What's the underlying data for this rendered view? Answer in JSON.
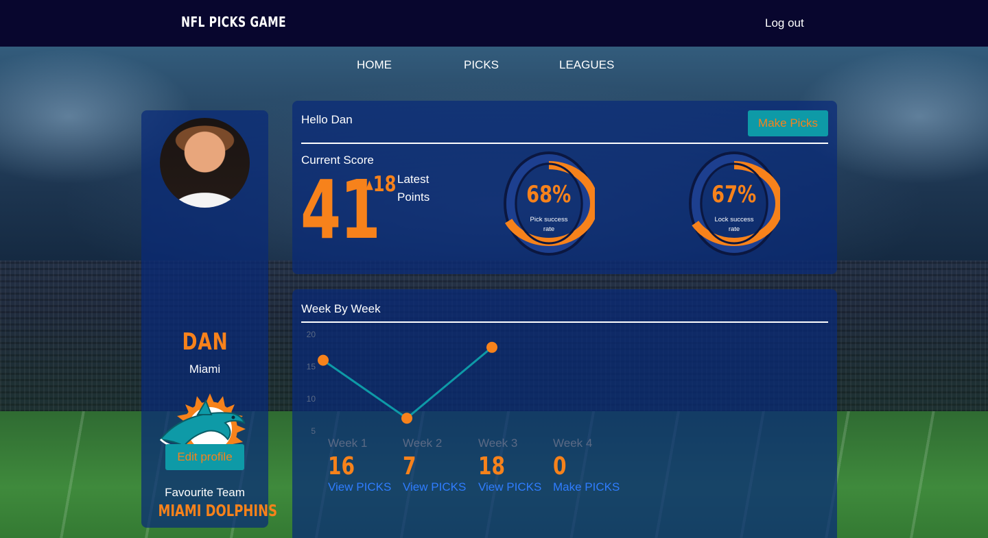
{
  "header": {
    "brand": "NFL PICKS GAME",
    "logout_label": "Log out"
  },
  "nav": {
    "items": [
      "HOME",
      "PICKS",
      "LEAGUES"
    ]
  },
  "profile": {
    "name": "DAN",
    "city": "Miami",
    "favourite_label": "Favourite Team",
    "favourite_team": "MIAMI DOLPHINS",
    "edit_label": "Edit profile"
  },
  "score": {
    "greeting": "Hello Dan",
    "make_picks_label": "Make Picks",
    "current_label": "Current Score",
    "current_value": "41",
    "delta": "18",
    "latest_label": "Latest Points",
    "gauges": [
      {
        "percent": 68,
        "percent_label": "68%",
        "caption": "Pick success rate"
      },
      {
        "percent": 67,
        "percent_label": "67%",
        "caption": "Lock success rate"
      }
    ]
  },
  "weekly": {
    "title": "Week By Week",
    "colors": {
      "line": "#0e9aa7",
      "point": "#f7821b",
      "accent": "#f7821b"
    },
    "chart_data": {
      "type": "line",
      "categories": [
        "Week 1",
        "Week 2",
        "Week 3"
      ],
      "values": [
        16,
        7,
        18
      ],
      "y_ticks": [
        "20",
        "15",
        "10",
        "5"
      ],
      "ylim": [
        0,
        20
      ]
    },
    "weeks": [
      {
        "label": "Week 1",
        "score": "16",
        "link": "View PICKS"
      },
      {
        "label": "Week 2",
        "score": "7",
        "link": "View PICKS"
      },
      {
        "label": "Week 3",
        "score": "18",
        "link": "View PICKS"
      },
      {
        "label": "Week 4",
        "score": "0",
        "link": "Make PICKS"
      }
    ]
  }
}
